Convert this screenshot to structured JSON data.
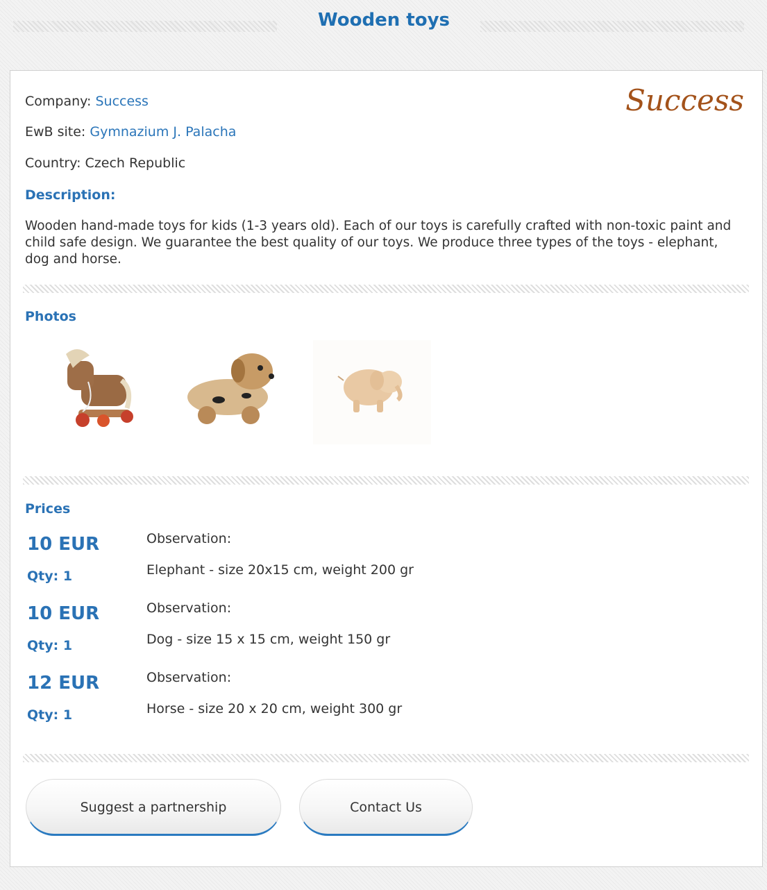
{
  "page": {
    "title": "Wooden toys"
  },
  "company": {
    "logo_text": "Success",
    "company_label": "Company:",
    "company_name": "Success",
    "ewb_label": "EwB site:",
    "ewb_site": "Gymnazium J. Palacha",
    "country_label": "Country:",
    "country": "Czech Republic"
  },
  "description": {
    "heading": "Description:",
    "text": "Wooden hand-made toys for kids (1-3 years old). Each of our toys is carefully crafted with non-toxic paint and child safe design. We guarantee the best quality of our toys. We produce three types of the toys - elephant, dog and horse."
  },
  "photos": {
    "heading": "Photos",
    "items": [
      "horse-toy-photo",
      "dog-toy-photo",
      "elephant-toy-photo"
    ]
  },
  "prices": {
    "heading": "Prices",
    "items": [
      {
        "price": "10 EUR",
        "qty": "Qty: 1",
        "obs_label": "Observation:",
        "obs_text": "Elephant - size 20x15 cm, weight 200 gr"
      },
      {
        "price": "10 EUR",
        "qty": "Qty: 1",
        "obs_label": "Observation:",
        "obs_text": "Dog - size 15 x 15 cm, weight 150 gr"
      },
      {
        "price": "12 EUR",
        "qty": "Qty: 1",
        "obs_label": "Observation:",
        "obs_text": "Horse - size 20 x 20 cm, weight 300 gr"
      }
    ]
  },
  "actions": {
    "suggest_label": "Suggest a partnership",
    "contact_label": "Contact Us"
  },
  "colors": {
    "accent": "#2a72b5",
    "logo": "#a3521a",
    "button_border": "#2a7ac0"
  }
}
